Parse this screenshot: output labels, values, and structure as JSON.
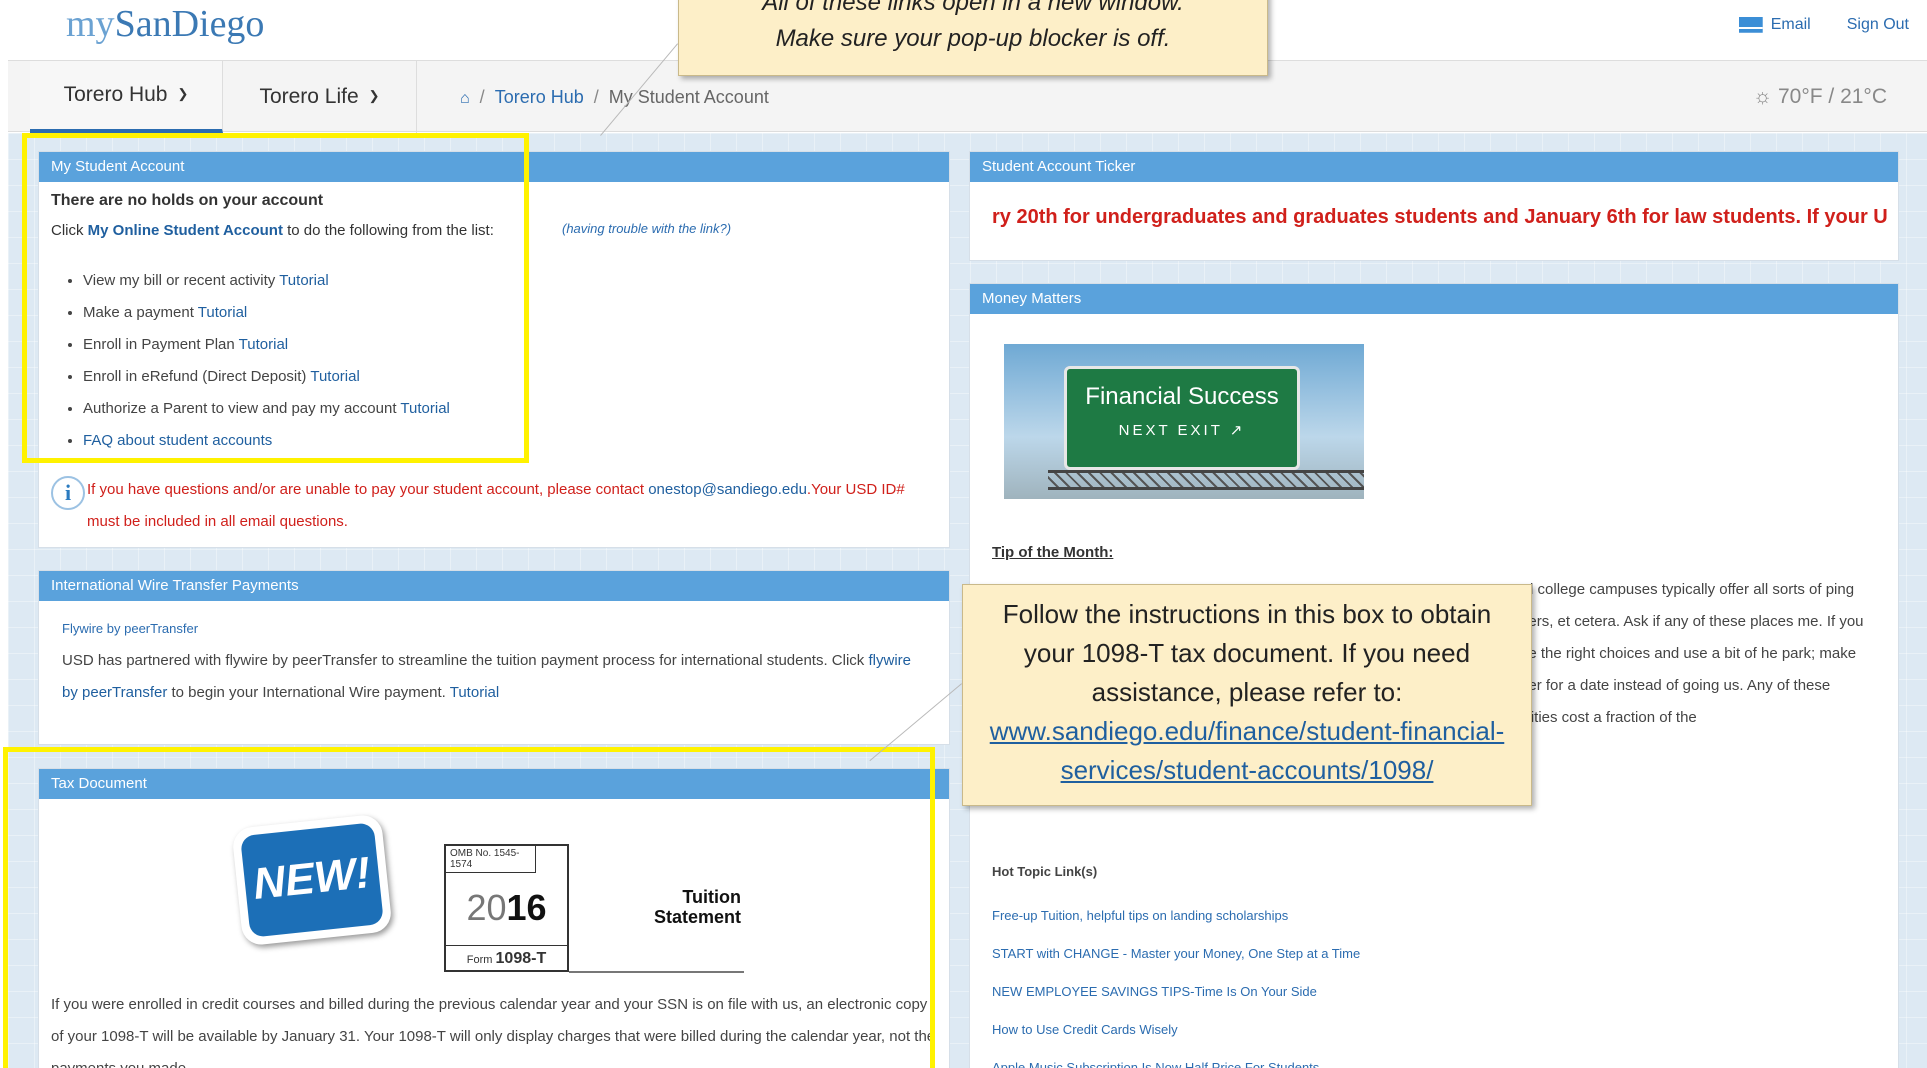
{
  "header": {
    "logo_my": "my",
    "logo_name": "SanDiego",
    "email_label": "Email",
    "signout_label": "Sign Out"
  },
  "nav": {
    "tabs": [
      {
        "label": "Torero Hub",
        "active": true
      },
      {
        "label": "Torero Life",
        "active": false
      }
    ],
    "breadcrumb": [
      "Torero Hub",
      "My Student Account"
    ],
    "weather": "☼ 70°F / 21°C"
  },
  "student_account": {
    "header": "My Student Account",
    "title": "There are no holds on your account",
    "intro_prefix": "Click",
    "intro_link": "My Online Student Account",
    "intro_suffix": "to do the following from the list:",
    "trouble_link": "(having trouble with the link?)",
    "items": [
      {
        "text": "View my bill or recent activity",
        "link": "Tutorial"
      },
      {
        "text": "Make a payment",
        "link": "Tutorial"
      },
      {
        "text": "Enroll in Payment Plan",
        "link": "Tutorial"
      },
      {
        "text": "Enroll in eRefund (Direct Deposit)",
        "link": "Tutorial"
      },
      {
        "text": "Authorize a Parent to view and pay my account",
        "link": "Tutorial"
      },
      {
        "text": "",
        "link": "FAQ about student accounts"
      }
    ],
    "info_prefix": "If you have questions and/or are unable to pay your student account, please contact",
    "info_email": "onestop@sandiego.edu",
    "info_suffix": ".Your USD ID# must be included in all email questions."
  },
  "wire": {
    "header": "International Wire Transfer Payments",
    "flywire_label": "Flywire by peerTransfer",
    "text1": "USD has partnered with flywire by peerTransfer to streamline the tuition payment process for international students. Click",
    "link1": "flywire by peerTransfer",
    "text2": "to begin your International Wire payment.",
    "link2": "Tutorial"
  },
  "tax": {
    "header": "Tax Document",
    "badge": "NEW!",
    "omb": "OMB No. 1545-1574",
    "year_light": "20",
    "year_bold": "16",
    "form_prefix": "Form",
    "form_name": "1098-T",
    "tuition_line1": "Tuition",
    "tuition_line2": "Statement",
    "text": "If you were enrolled in credit courses and billed during the previous calendar year and your SSN is on file with us, an electronic copy of your 1098-T will be available by January 31. Your 1098-T will only display charges that were billed during the calendar year, not the payments you made."
  },
  "ticker": {
    "header": "Student Account Ticker",
    "text": "ry 20th for undergraduates and graduates students and January 6th for law students. If your U"
  },
  "money": {
    "header": "Money Matters",
    "sign_line1": "Financial Success",
    "sign_line2": "NEXT EXIT ↗",
    "tip_title": "Tip of the Month:",
    "tip_text": ", and college campuses typically offer all sorts of ping centers, et cetera. Ask if any of these places me. If you make the right choices and use a bit of he park; make dinner for a date instead of going us. Any of these activities cost a fraction of the",
    "hot_title": "Hot Topic Link(s)",
    "hot_links": [
      "Free-up Tuition, helpful tips on landing scholarships",
      "START with CHANGE - Master your Money, One Step at a Time",
      "NEW EMPLOYEE SAVINGS TIPS-Time Is On Your Side",
      "How to Use Credit Cards Wisely",
      "Apple Music Subscription Is Now Half Price For Students"
    ]
  },
  "callouts": {
    "top_line1": "All of these links open in a new window.",
    "top_line2": "Make sure your pop-up blocker is off.",
    "tax_text": "Follow the instructions in this box to obtain your 1098-T tax document. If you need assistance, please refer to:",
    "tax_link": "www.sandiego.edu/finance/student-financial-services/student-accounts/1098/"
  },
  "colors": {
    "panel_header": "#5aa2dc",
    "highlight": "#fff200",
    "alert_red": "#d0201b",
    "link": "#2b6cb0"
  }
}
